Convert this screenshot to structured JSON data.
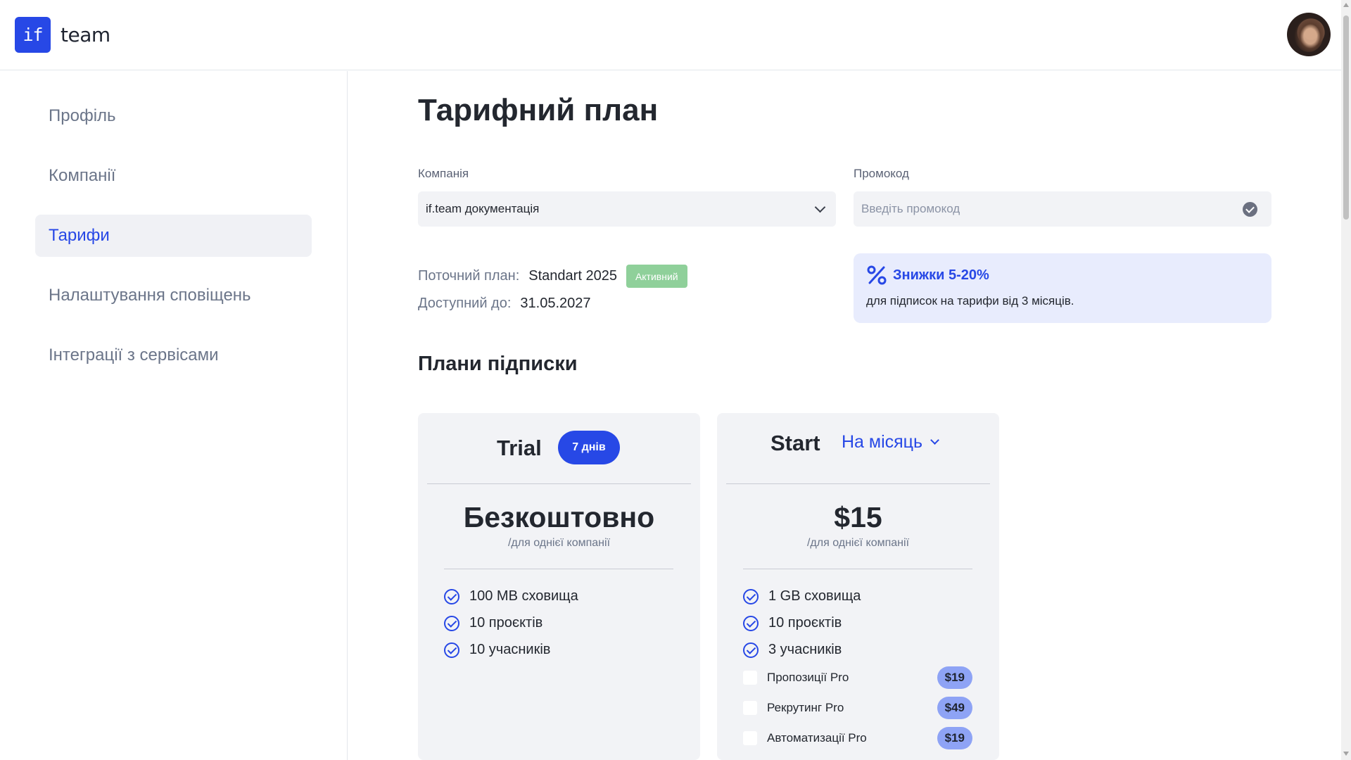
{
  "brand": {
    "logo_mark": "if",
    "name": "team"
  },
  "sidebar": {
    "items": [
      {
        "label": "Профіль"
      },
      {
        "label": "Компанії"
      },
      {
        "label": "Тарифи",
        "active": true
      },
      {
        "label": "Налаштування сповіщень"
      },
      {
        "label": "Інтеграції з сервісами"
      }
    ]
  },
  "page": {
    "title": "Тарифний план"
  },
  "company": {
    "label": "Компанія",
    "value": "if.team документація"
  },
  "promo": {
    "label": "Промокод",
    "placeholder": "Введіть промокод",
    "value": ""
  },
  "current_plan": {
    "plan_label": "Поточний план:",
    "plan_value": "Standart 2025",
    "status": "Активний",
    "until_label": "Доступний до:",
    "until_value": "31.05.2027"
  },
  "discount": {
    "title": "Знижки 5-20%",
    "text": "для підписок на тарифи від 3 місяців."
  },
  "plans_section": {
    "title": "Плани підписки"
  },
  "plans": [
    {
      "name": "Trial",
      "badge": "7 днів",
      "price": "Безкоштовно",
      "per": "/для однієї компанії",
      "features": [
        "100 MB сховища",
        "10 проєктів",
        "10 учасників"
      ]
    },
    {
      "name": "Start",
      "period": "На місяць",
      "price": "$15",
      "per": "/для однієї компанії",
      "features": [
        "1 GB сховища",
        "10 проєктів",
        "3 учасників"
      ],
      "addons": [
        {
          "label": "Пропозиції Pro",
          "price": "$19",
          "checked": false
        },
        {
          "label": "Рекрутинг Pro",
          "price": "$49",
          "checked": false
        },
        {
          "label": "Автоматизації Pro",
          "price": "$19",
          "checked": false
        }
      ]
    }
  ],
  "colors": {
    "accent": "#2748e6",
    "active_badge": "#8fd09a",
    "addon_price": "#8ea3f5",
    "discount_bg": "#e8ecfd"
  },
  "icons": {
    "discount": "percent-icon",
    "promo_apply": "check-circle-icon",
    "feature": "check-circle-icon",
    "select": "chevron-down-icon"
  }
}
